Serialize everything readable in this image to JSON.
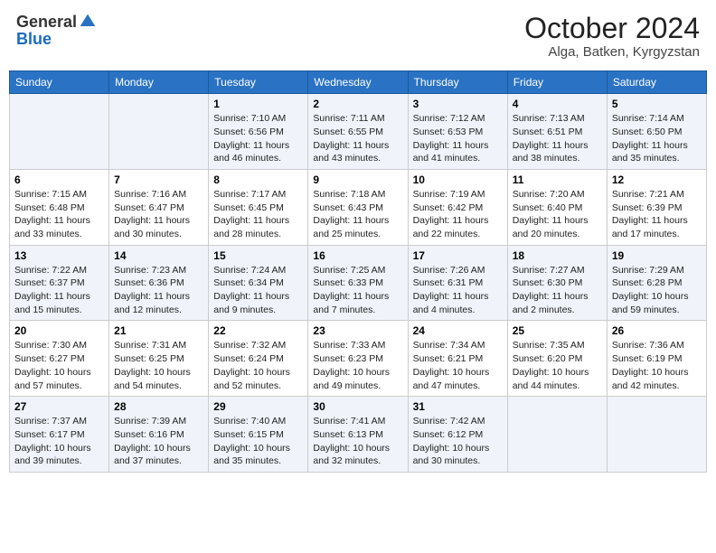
{
  "header": {
    "logo_general": "General",
    "logo_blue": "Blue",
    "month": "October 2024",
    "location": "Alga, Batken, Kyrgyzstan"
  },
  "days_of_week": [
    "Sunday",
    "Monday",
    "Tuesday",
    "Wednesday",
    "Thursday",
    "Friday",
    "Saturday"
  ],
  "weeks": [
    [
      {
        "day": "",
        "content": ""
      },
      {
        "day": "",
        "content": ""
      },
      {
        "day": "1",
        "content": "Sunrise: 7:10 AM\nSunset: 6:56 PM\nDaylight: 11 hours and 46 minutes."
      },
      {
        "day": "2",
        "content": "Sunrise: 7:11 AM\nSunset: 6:55 PM\nDaylight: 11 hours and 43 minutes."
      },
      {
        "day": "3",
        "content": "Sunrise: 7:12 AM\nSunset: 6:53 PM\nDaylight: 11 hours and 41 minutes."
      },
      {
        "day": "4",
        "content": "Sunrise: 7:13 AM\nSunset: 6:51 PM\nDaylight: 11 hours and 38 minutes."
      },
      {
        "day": "5",
        "content": "Sunrise: 7:14 AM\nSunset: 6:50 PM\nDaylight: 11 hours and 35 minutes."
      }
    ],
    [
      {
        "day": "6",
        "content": "Sunrise: 7:15 AM\nSunset: 6:48 PM\nDaylight: 11 hours and 33 minutes."
      },
      {
        "day": "7",
        "content": "Sunrise: 7:16 AM\nSunset: 6:47 PM\nDaylight: 11 hours and 30 minutes."
      },
      {
        "day": "8",
        "content": "Sunrise: 7:17 AM\nSunset: 6:45 PM\nDaylight: 11 hours and 28 minutes."
      },
      {
        "day": "9",
        "content": "Sunrise: 7:18 AM\nSunset: 6:43 PM\nDaylight: 11 hours and 25 minutes."
      },
      {
        "day": "10",
        "content": "Sunrise: 7:19 AM\nSunset: 6:42 PM\nDaylight: 11 hours and 22 minutes."
      },
      {
        "day": "11",
        "content": "Sunrise: 7:20 AM\nSunset: 6:40 PM\nDaylight: 11 hours and 20 minutes."
      },
      {
        "day": "12",
        "content": "Sunrise: 7:21 AM\nSunset: 6:39 PM\nDaylight: 11 hours and 17 minutes."
      }
    ],
    [
      {
        "day": "13",
        "content": "Sunrise: 7:22 AM\nSunset: 6:37 PM\nDaylight: 11 hours and 15 minutes."
      },
      {
        "day": "14",
        "content": "Sunrise: 7:23 AM\nSunset: 6:36 PM\nDaylight: 11 hours and 12 minutes."
      },
      {
        "day": "15",
        "content": "Sunrise: 7:24 AM\nSunset: 6:34 PM\nDaylight: 11 hours and 9 minutes."
      },
      {
        "day": "16",
        "content": "Sunrise: 7:25 AM\nSunset: 6:33 PM\nDaylight: 11 hours and 7 minutes."
      },
      {
        "day": "17",
        "content": "Sunrise: 7:26 AM\nSunset: 6:31 PM\nDaylight: 11 hours and 4 minutes."
      },
      {
        "day": "18",
        "content": "Sunrise: 7:27 AM\nSunset: 6:30 PM\nDaylight: 11 hours and 2 minutes."
      },
      {
        "day": "19",
        "content": "Sunrise: 7:29 AM\nSunset: 6:28 PM\nDaylight: 10 hours and 59 minutes."
      }
    ],
    [
      {
        "day": "20",
        "content": "Sunrise: 7:30 AM\nSunset: 6:27 PM\nDaylight: 10 hours and 57 minutes."
      },
      {
        "day": "21",
        "content": "Sunrise: 7:31 AM\nSunset: 6:25 PM\nDaylight: 10 hours and 54 minutes."
      },
      {
        "day": "22",
        "content": "Sunrise: 7:32 AM\nSunset: 6:24 PM\nDaylight: 10 hours and 52 minutes."
      },
      {
        "day": "23",
        "content": "Sunrise: 7:33 AM\nSunset: 6:23 PM\nDaylight: 10 hours and 49 minutes."
      },
      {
        "day": "24",
        "content": "Sunrise: 7:34 AM\nSunset: 6:21 PM\nDaylight: 10 hours and 47 minutes."
      },
      {
        "day": "25",
        "content": "Sunrise: 7:35 AM\nSunset: 6:20 PM\nDaylight: 10 hours and 44 minutes."
      },
      {
        "day": "26",
        "content": "Sunrise: 7:36 AM\nSunset: 6:19 PM\nDaylight: 10 hours and 42 minutes."
      }
    ],
    [
      {
        "day": "27",
        "content": "Sunrise: 7:37 AM\nSunset: 6:17 PM\nDaylight: 10 hours and 39 minutes."
      },
      {
        "day": "28",
        "content": "Sunrise: 7:39 AM\nSunset: 6:16 PM\nDaylight: 10 hours and 37 minutes."
      },
      {
        "day": "29",
        "content": "Sunrise: 7:40 AM\nSunset: 6:15 PM\nDaylight: 10 hours and 35 minutes."
      },
      {
        "day": "30",
        "content": "Sunrise: 7:41 AM\nSunset: 6:13 PM\nDaylight: 10 hours and 32 minutes."
      },
      {
        "day": "31",
        "content": "Sunrise: 7:42 AM\nSunset: 6:12 PM\nDaylight: 10 hours and 30 minutes."
      },
      {
        "day": "",
        "content": ""
      },
      {
        "day": "",
        "content": ""
      }
    ]
  ]
}
